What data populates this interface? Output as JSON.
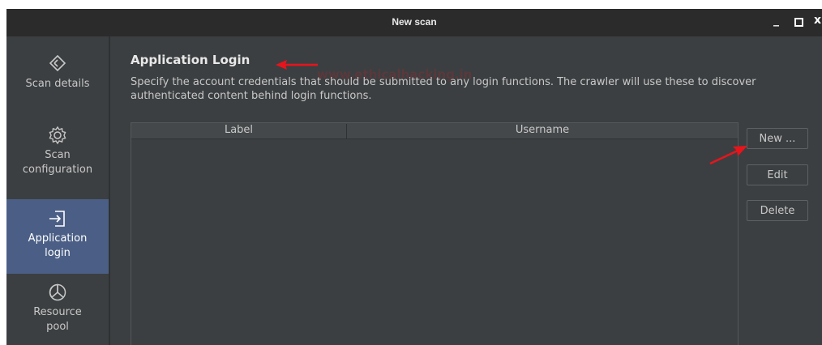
{
  "window": {
    "title": "New scan",
    "controls": {
      "minimize": "_",
      "close": "x"
    }
  },
  "sidebar": {
    "items": [
      {
        "label": "Scan details",
        "icon": "scan-details-icon",
        "active": false
      },
      {
        "label": "Scan configuration",
        "icon": "gear-icon",
        "active": false
      },
      {
        "label": "Application login",
        "icon": "login-arrow-icon",
        "active": true
      },
      {
        "label": "Resource pool",
        "icon": "pie-chart-icon",
        "active": false
      }
    ]
  },
  "main": {
    "heading": "Application Login",
    "description": "Specify the account credentials that should be submitted to any login functions. The crawler will use these to discover authenticated content behind login functions.",
    "watermark": "www.ethicalhacking.in",
    "table": {
      "columns": [
        "Label",
        "Username"
      ],
      "rows": []
    },
    "buttons": {
      "new": "New ...",
      "edit": "Edit",
      "delete": "Delete"
    }
  },
  "colors": {
    "window_bg": "#3c3f41",
    "titlebar_bg": "#2b2b2b",
    "active_item_bg": "#4b5f86",
    "annotation_arrow": "#e8141c"
  }
}
